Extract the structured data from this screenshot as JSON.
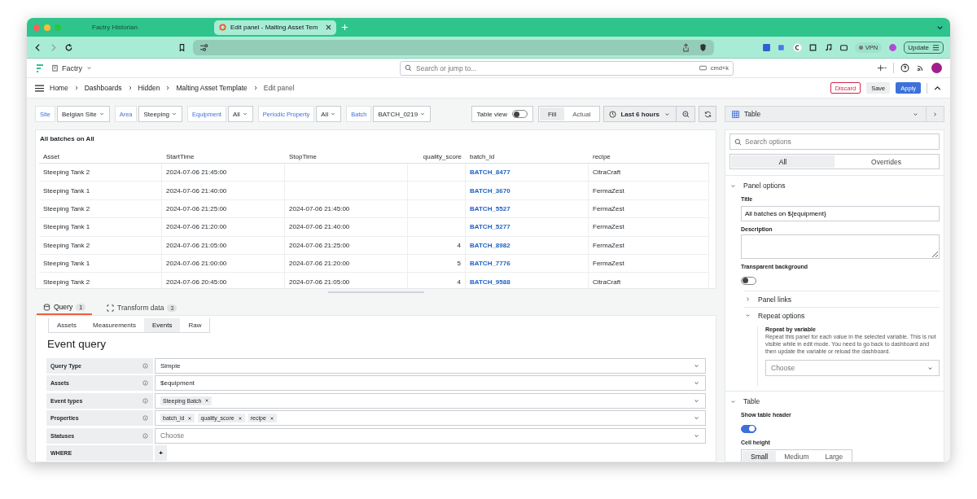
{
  "browser": {
    "tabs": [
      {
        "title": "Factry Historian",
        "selected": false
      },
      {
        "title": "Edit panel - Malting Asset Tem",
        "selected": true
      }
    ],
    "vpn": "VPN",
    "update": "Update"
  },
  "topbar": {
    "org": "Factry",
    "search_placeholder": "Search or jump to...",
    "shortcut": "cmd+k"
  },
  "breadcrumbs": [
    "Home",
    "Dashboards",
    "Hidden",
    "Malting Asset Template",
    "Edit panel"
  ],
  "actions": {
    "discard": "Discard",
    "save": "Save",
    "apply": "Apply"
  },
  "variables": [
    {
      "label": "Site",
      "value": "Belgian Site"
    },
    {
      "label": "Area",
      "value": "Steeping"
    },
    {
      "label": "Equipment",
      "value": "All"
    },
    {
      "label": "Periodic Property",
      "value": "All"
    },
    {
      "label": "Batch",
      "value": "BATCH_0219"
    }
  ],
  "table_view": {
    "label": "Table view",
    "on": false
  },
  "fill_modes": [
    {
      "label": "Fill",
      "selected": true
    },
    {
      "label": "Actual",
      "selected": false
    }
  ],
  "time_range": "Last 6 hours",
  "panel": {
    "title": "All batches on All",
    "columns": [
      {
        "label": "Asset",
        "kind": "text"
      },
      {
        "label": "StartTime",
        "kind": "text"
      },
      {
        "label": "StopTime",
        "kind": "text"
      },
      {
        "label": "quality_score",
        "kind": "number"
      },
      {
        "label": "batch_id",
        "kind": "link"
      },
      {
        "label": "recipe",
        "kind": "text"
      }
    ],
    "rows": [
      [
        "Steeping Tank 2",
        "2024-07-06 21:45:00",
        "",
        "",
        "BATCH_8477",
        "CitraCraft"
      ],
      [
        "Steeping Tank 1",
        "2024-07-06 21:40:00",
        "",
        "",
        "BATCH_3670",
        "FermaZest"
      ],
      [
        "Steeping Tank 2",
        "2024-07-06 21:25:00",
        "2024-07-06 21:45:00",
        "",
        "BATCH_5527",
        "FermaZest"
      ],
      [
        "Steeping Tank 1",
        "2024-07-06 21:20:00",
        "2024-07-06 21:40:00",
        "",
        "BATCH_5277",
        "FermaZest"
      ],
      [
        "Steeping Tank 2",
        "2024-07-06 21:05:00",
        "2024-07-06 21:25:00",
        "4",
        "BATCH_8982",
        "FermaZest"
      ],
      [
        "Steeping Tank 1",
        "2024-07-06 21:00:00",
        "2024-07-06 21:20:00",
        "5",
        "BATCH_7776",
        "FermaZest"
      ],
      [
        "Steeping Tank 2",
        "2024-07-06 20:45:00",
        "2024-07-06 21:05:00",
        "4",
        "BATCH_9588",
        "CitraCraft"
      ]
    ]
  },
  "query_tabs": [
    {
      "label": "Query",
      "count": "1",
      "selected": true
    },
    {
      "label": "Transform data",
      "count": "3",
      "selected": false
    }
  ],
  "source_tabs": [
    {
      "label": "Assets",
      "selected": false
    },
    {
      "label": "Measurements",
      "selected": false
    },
    {
      "label": "Events",
      "selected": true
    },
    {
      "label": "Raw",
      "selected": false
    }
  ],
  "editor": {
    "heading": "Event query",
    "fields": [
      {
        "label": "Query Type",
        "kind": "select",
        "value": "Simple"
      },
      {
        "label": "Assets",
        "kind": "select",
        "value": "$equipment"
      },
      {
        "label": "Event types",
        "kind": "tags",
        "tags": [
          "Steeping Batch"
        ]
      },
      {
        "label": "Properties",
        "kind": "tags",
        "tags": [
          "batch_id",
          "quality_score",
          "recipe"
        ]
      },
      {
        "label": "Statuses",
        "kind": "select",
        "placeholder": "Choose"
      },
      {
        "label": "WHERE",
        "kind": "add",
        "add_label": "+"
      }
    ]
  },
  "options": {
    "visualization": "Table",
    "search_placeholder": "Search options",
    "mode_tabs": [
      {
        "label": "All",
        "selected": true
      },
      {
        "label": "Overrides",
        "selected": false
      }
    ],
    "panel_options": {
      "heading": "Panel options",
      "expanded": true,
      "title_label": "Title",
      "title_value": "All batches on ${equipment}",
      "description_label": "Description",
      "transparent_label": "Transparent background",
      "transparent_on": false
    },
    "panel_links": {
      "heading": "Panel links",
      "expanded": false
    },
    "repeat": {
      "heading": "Repeat options",
      "expanded": true,
      "label": "Repeat by variable",
      "description": "Repeat this panel for each value in the selected variable. This is not visible while in edit mode. You need to go back to dashboard and then update the variable or reload the dashboard.",
      "placeholder": "Choose"
    },
    "table": {
      "heading": "Table",
      "expanded": true,
      "header_label": "Show table header",
      "header_on": true,
      "cell_height_label": "Cell height",
      "cell_heights": [
        {
          "label": "Small",
          "selected": true
        },
        {
          "label": "Medium",
          "selected": false
        },
        {
          "label": "Large",
          "selected": false
        }
      ]
    }
  }
}
